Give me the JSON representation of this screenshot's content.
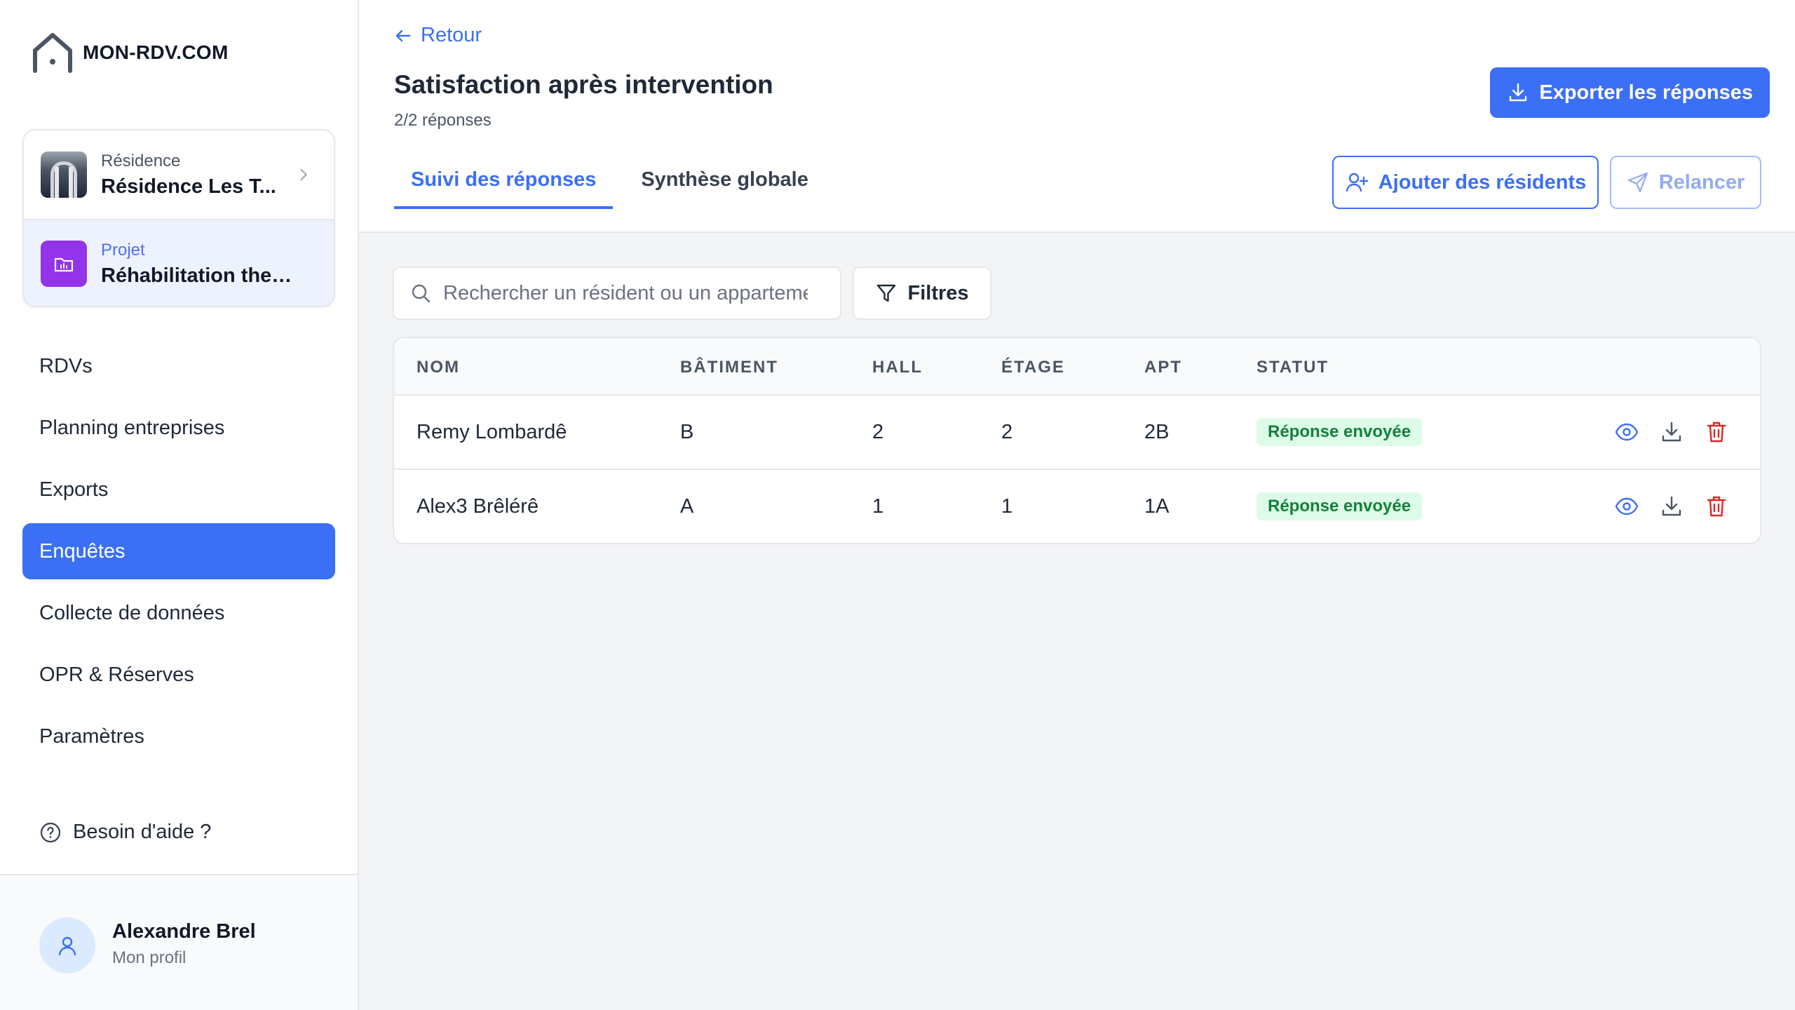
{
  "app": {
    "logo_text": "MON-RDV.COM"
  },
  "context": {
    "residence": {
      "label": "Résidence",
      "value": "Résidence Les T..."
    },
    "project": {
      "label": "Projet",
      "value": "Réhabilitation therm..."
    }
  },
  "nav": {
    "items": [
      {
        "label": "RDVs"
      },
      {
        "label": "Planning entreprises"
      },
      {
        "label": "Exports"
      },
      {
        "label": "Enquêtes",
        "active": true
      },
      {
        "label": "Collecte de données"
      },
      {
        "label": "OPR & Réserves"
      },
      {
        "label": "Paramètres"
      }
    ],
    "help": "Besoin d'aide ?"
  },
  "profile": {
    "name": "Alexandre Brel",
    "sub": "Mon profil"
  },
  "header": {
    "back": "Retour",
    "title": "Satisfaction après intervention",
    "subtitle": "2/2 réponses",
    "export_button": "Exporter les réponses",
    "tabs": [
      {
        "label": "Suivi des réponses",
        "active": true
      },
      {
        "label": "Synthèse globale"
      }
    ],
    "add_button": "Ajouter des résidents",
    "relaunch_button": "Relancer"
  },
  "search": {
    "placeholder": "Rechercher un résident ou un appartement",
    "value": ""
  },
  "filter_button": "Filtres",
  "table": {
    "columns": [
      "NOM",
      "BÂTIMENT",
      "HALL",
      "ÉTAGE",
      "APT",
      "STATUT"
    ],
    "rows": [
      {
        "nom": "Remy Lombardê",
        "batiment": "B",
        "hall": "2",
        "etage": "2",
        "apt": "2B",
        "statut": "Réponse envoyée"
      },
      {
        "nom": "Alex3 Brêlérê",
        "batiment": "A",
        "hall": "1",
        "etage": "1",
        "apt": "1A",
        "statut": "Réponse envoyée"
      }
    ]
  },
  "colors": {
    "primary": "#3b6ff5",
    "success_bg": "#dcfce7",
    "success_text": "#15803d",
    "danger": "#dc2626",
    "project_icon": "#9333ea"
  },
  "icons": [
    "home-logo-icon",
    "chevron-right-icon",
    "folder-icon",
    "help-circle-icon",
    "user-icon",
    "arrow-left-icon",
    "download-icon",
    "user-plus-icon",
    "send-icon",
    "search-icon",
    "filter-icon",
    "eye-icon",
    "trash-icon"
  ]
}
